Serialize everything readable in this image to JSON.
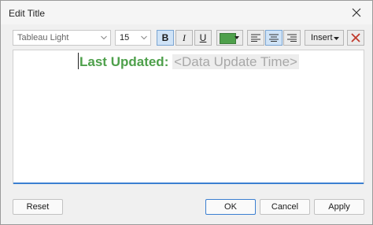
{
  "window": {
    "title": "Edit Title"
  },
  "toolbar": {
    "font": "Tableau Light",
    "size": "15",
    "bold": "B",
    "italic": "I",
    "underline": "U",
    "text_color": "#4ea04b",
    "insert_label": "Insert"
  },
  "editor": {
    "static_text": "Last Updated:",
    "field_text": "<Data Update Time>"
  },
  "buttons": {
    "reset": "Reset",
    "ok": "OK",
    "cancel": "Cancel",
    "apply": "Apply"
  }
}
